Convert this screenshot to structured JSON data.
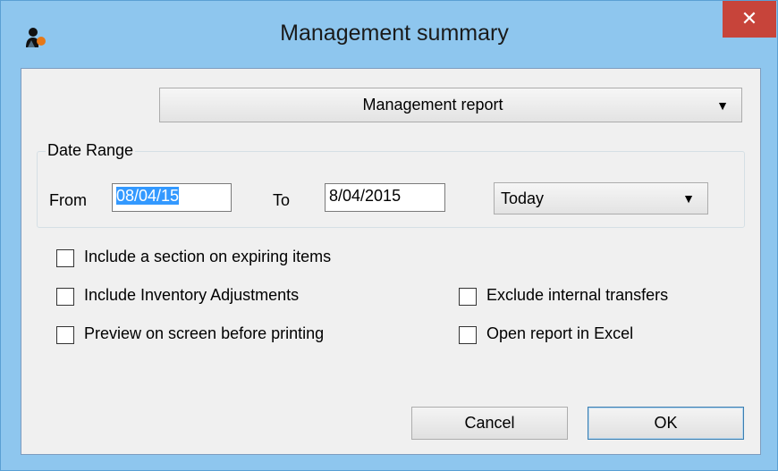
{
  "window": {
    "title": "Management summary",
    "close_glyph": "✕",
    "app_icon": "user-icon"
  },
  "report_type": {
    "selected": "Management report",
    "arrow": "▼"
  },
  "date_range": {
    "group_label": "Date Range",
    "from_label": "From",
    "from_value": "08/04/15",
    "to_label": "To",
    "to_value": "8/04/2015",
    "preset_selected": "Today",
    "preset_arrow": "▼"
  },
  "options": {
    "expiring_items": {
      "label": "Include a section on expiring items",
      "checked": false
    },
    "inventory_adjustments": {
      "label": "Include Inventory Adjustments",
      "checked": false
    },
    "exclude_internal_transfers": {
      "label": "Exclude internal transfers",
      "checked": false
    },
    "preview_on_screen": {
      "label": "Preview on screen before printing",
      "checked": false
    },
    "open_in_excel": {
      "label": "Open report in Excel",
      "checked": false
    }
  },
  "buttons": {
    "cancel": "Cancel",
    "ok": "OK"
  },
  "colors": {
    "frame": "#8ec6ee",
    "close": "#c7443a",
    "selection": "#3399ff",
    "dialog_bg": "#f0f0f0"
  }
}
